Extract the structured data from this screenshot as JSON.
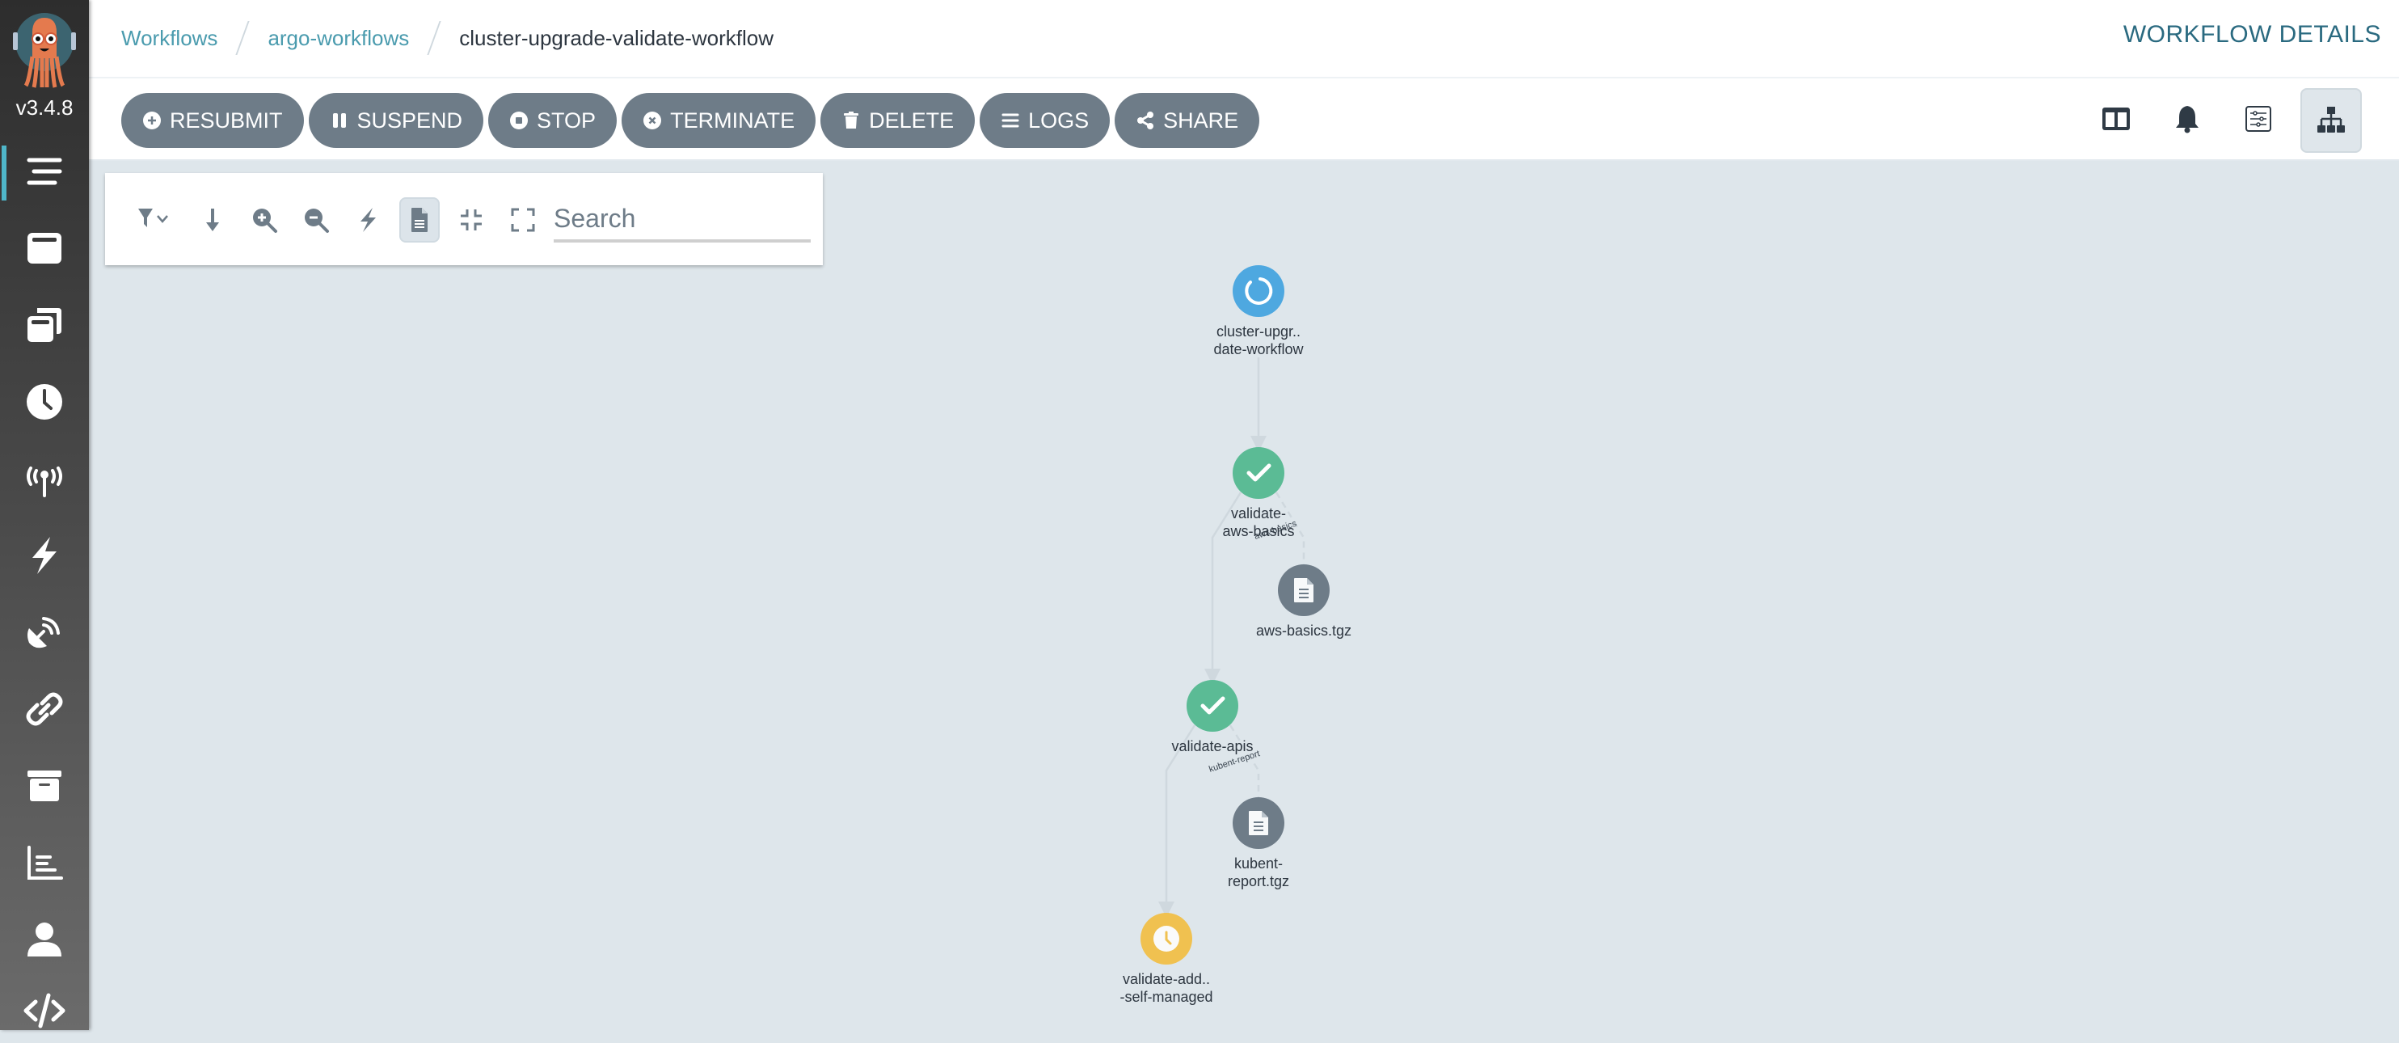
{
  "app": {
    "version": "v3.4.8",
    "logo": "argo-octopus-logo"
  },
  "sidebar": {
    "items": [
      {
        "name": "workflows",
        "icon": "bars-icon",
        "active": true
      },
      {
        "name": "workflow-templates",
        "icon": "window-icon"
      },
      {
        "name": "cluster-workflow-templates",
        "icon": "window-restore-icon"
      },
      {
        "name": "cron-workflows",
        "icon": "clock-icon"
      },
      {
        "name": "event-sources",
        "icon": "broadcast-tower-icon"
      },
      {
        "name": "sensors",
        "icon": "bolt-icon"
      },
      {
        "name": "event-flow",
        "icon": "satellite-dish-icon"
      },
      {
        "name": "api-docs-links",
        "icon": "link-icon"
      },
      {
        "name": "archived-workflows",
        "icon": "archive-icon"
      },
      {
        "name": "reports",
        "icon": "chart-bar-icon"
      },
      {
        "name": "user",
        "icon": "user-icon"
      },
      {
        "name": "api-docs",
        "icon": "code-icon"
      }
    ]
  },
  "header": {
    "breadcrumbs": [
      {
        "label": "Workflows",
        "link": true
      },
      {
        "label": "argo-workflows",
        "link": true
      },
      {
        "label": "cluster-upgrade-validate-workflow",
        "link": false
      }
    ],
    "title": "WORKFLOW DETAILS"
  },
  "toolbar": {
    "actions": [
      {
        "label": "RESUBMIT",
        "icon": "plus-circle-icon"
      },
      {
        "label": "SUSPEND",
        "icon": "pause-icon"
      },
      {
        "label": "STOP",
        "icon": "stop-circle-icon"
      },
      {
        "label": "TERMINATE",
        "icon": "times-circle-icon"
      },
      {
        "label": "DELETE",
        "icon": "trash-icon"
      },
      {
        "label": "LOGS",
        "icon": "bars-icon"
      },
      {
        "label": "SHARE",
        "icon": "share-alt-icon"
      }
    ],
    "views": [
      {
        "name": "summary-view",
        "icon": "columns-icon"
      },
      {
        "name": "events-view",
        "icon": "bell-icon"
      },
      {
        "name": "yaml-view",
        "icon": "sliders-icon"
      },
      {
        "name": "graph-view",
        "icon": "sitemap-icon",
        "active": true
      }
    ]
  },
  "graph_toolbar": {
    "tools": [
      {
        "name": "filter",
        "icon": "filter-icon"
      },
      {
        "name": "direction",
        "icon": "arrow-down-icon"
      },
      {
        "name": "zoom-in",
        "icon": "zoom-in-icon"
      },
      {
        "name": "zoom-out",
        "icon": "zoom-out-icon"
      },
      {
        "name": "fast-render",
        "icon": "bolt-icon"
      },
      {
        "name": "show-artifacts",
        "icon": "file-icon",
        "active": true
      },
      {
        "name": "collapse",
        "icon": "compress-icon"
      },
      {
        "name": "fullscreen",
        "icon": "expand-icon"
      }
    ],
    "search_placeholder": "Search",
    "search_value": ""
  },
  "colors": {
    "running": "#4ea8e0",
    "succeeded": "#5bbb95",
    "pending": "#f0c150",
    "artifact": "#6e7c88",
    "edge": "#cfd8de",
    "link": "#4a9bae",
    "title": "#2a6a80"
  },
  "workflow_graph": {
    "nodes": [
      {
        "id": "root",
        "label_lines": [
          "cluster-upgr..",
          "date-workflow"
        ],
        "status": "running",
        "icon": "spinner-icon"
      },
      {
        "id": "aws-basics",
        "label_lines": [
          "validate-",
          "aws-basics"
        ],
        "status": "succeeded",
        "icon": "check-icon"
      },
      {
        "id": "aws-basics-artifact",
        "label_lines": [
          "aws-basics.tgz"
        ],
        "status": "artifact",
        "icon": "file-icon"
      },
      {
        "id": "apis",
        "label_lines": [
          "validate-apis"
        ],
        "status": "succeeded",
        "icon": "check-icon"
      },
      {
        "id": "kubent-artifact",
        "label_lines": [
          "kubent-",
          "report.tgz"
        ],
        "status": "artifact",
        "icon": "file-icon"
      },
      {
        "id": "self-managed",
        "label_lines": [
          "validate-add..",
          "-self-managed"
        ],
        "status": "pending",
        "icon": "clock-icon"
      }
    ],
    "edges": [
      {
        "from": "root",
        "to": "aws-basics",
        "label": "",
        "style": "solid"
      },
      {
        "from": "aws-basics",
        "to": "aws-basics-artifact",
        "label": "aws-basics",
        "style": "dashed"
      },
      {
        "from": "aws-basics",
        "to": "apis",
        "label": "",
        "style": "solid"
      },
      {
        "from": "apis",
        "to": "kubent-artifact",
        "label": "kubent-report",
        "style": "dashed"
      },
      {
        "from": "apis",
        "to": "self-managed",
        "label": "",
        "style": "solid"
      }
    ]
  }
}
